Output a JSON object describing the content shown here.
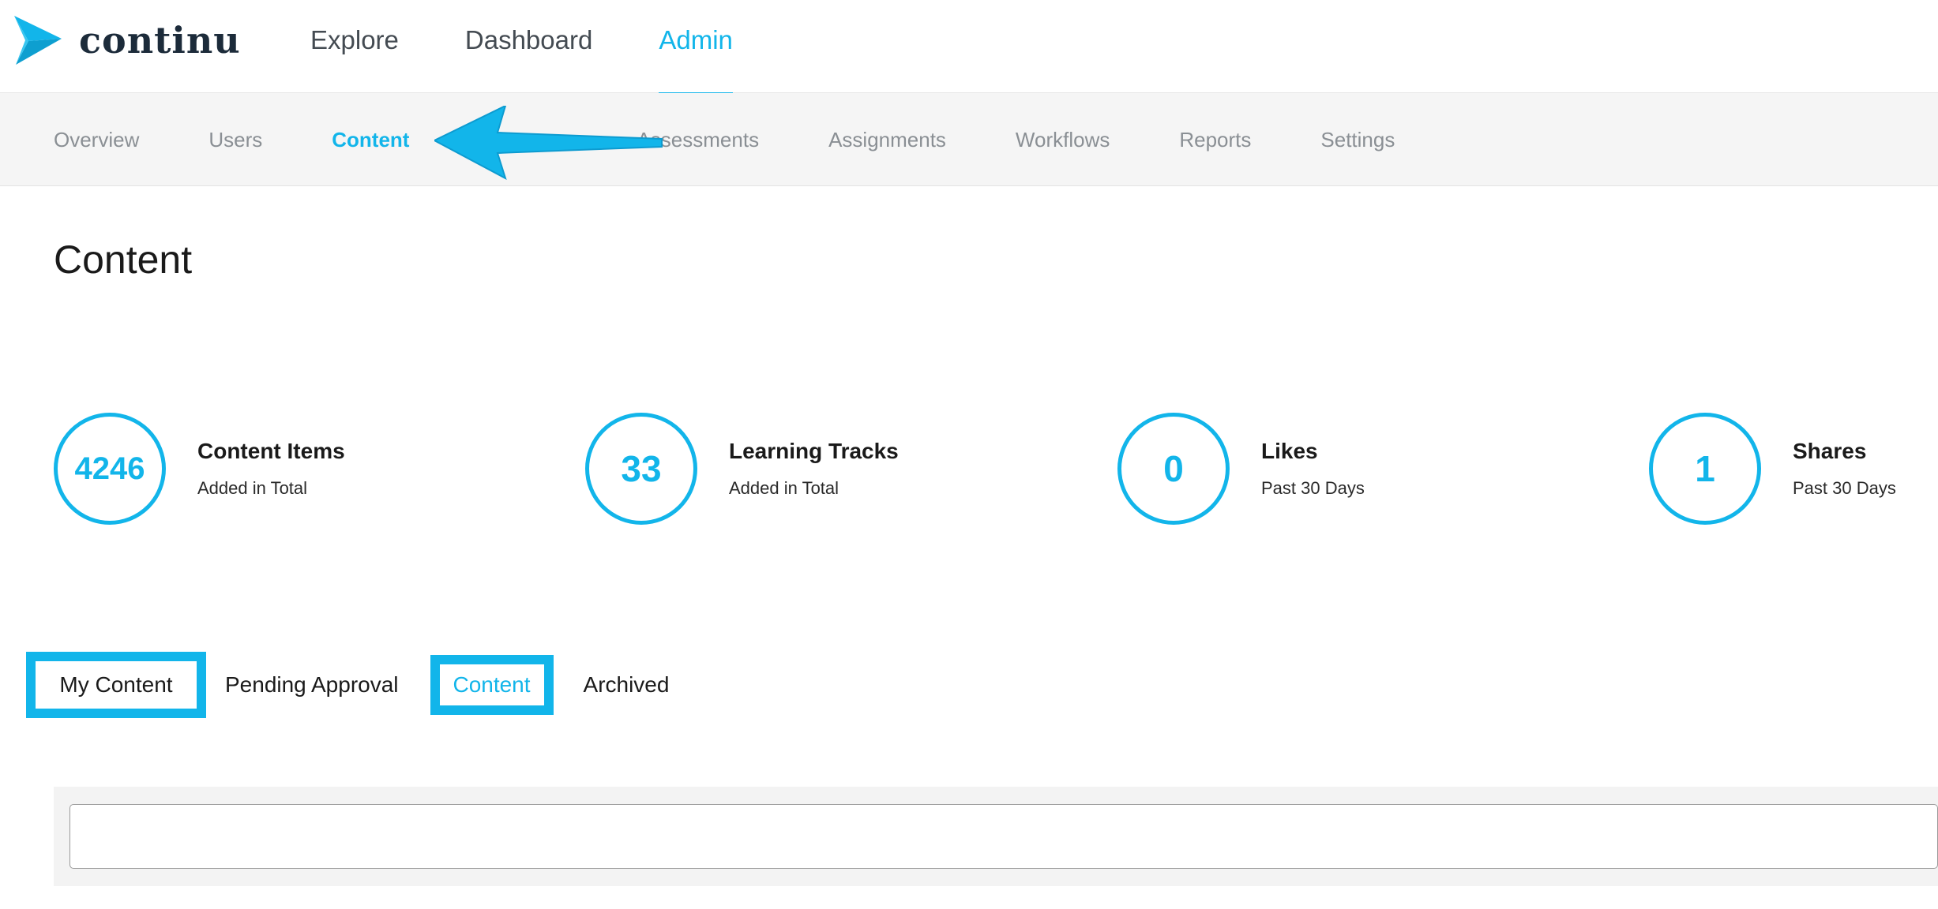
{
  "app": {
    "brand": "continu",
    "accent_color": "#12b5ea",
    "logo_icon": "chevron-arrow-logo-icon"
  },
  "top_nav": {
    "items": [
      {
        "label": "Explore",
        "active": false
      },
      {
        "label": "Dashboard",
        "active": false
      },
      {
        "label": "Admin",
        "active": true
      }
    ]
  },
  "sub_nav": {
    "items": [
      {
        "label": "Overview",
        "active": false
      },
      {
        "label": "Users",
        "active": false
      },
      {
        "label": "Content",
        "active": true
      },
      {
        "label": "Assessments",
        "active": false
      },
      {
        "label": "Assignments",
        "active": false
      },
      {
        "label": "Workflows",
        "active": false
      },
      {
        "label": "Reports",
        "active": false
      },
      {
        "label": "Settings",
        "active": false
      }
    ]
  },
  "page": {
    "title": "Content"
  },
  "stats": [
    {
      "value": "4246",
      "title": "Content Items",
      "subtitle": "Added in Total"
    },
    {
      "value": "33",
      "title": "Learning Tracks",
      "subtitle": "Added in Total"
    },
    {
      "value": "0",
      "title": "Likes",
      "subtitle": "Past 30 Days"
    },
    {
      "value": "1",
      "title": "Shares",
      "subtitle": "Past 30 Days"
    }
  ],
  "content_tabs": {
    "items": [
      {
        "label": "My Content",
        "highlighted": true
      },
      {
        "label": "Pending Approval",
        "highlighted": false
      },
      {
        "label": "Content",
        "highlighted": true,
        "active": true
      },
      {
        "label": "Archived",
        "highlighted": false
      }
    ]
  },
  "search": {
    "value": "",
    "placeholder": ""
  },
  "annotation": {
    "icon": "annotation-arrow-icon",
    "color": "#12b5ea"
  }
}
